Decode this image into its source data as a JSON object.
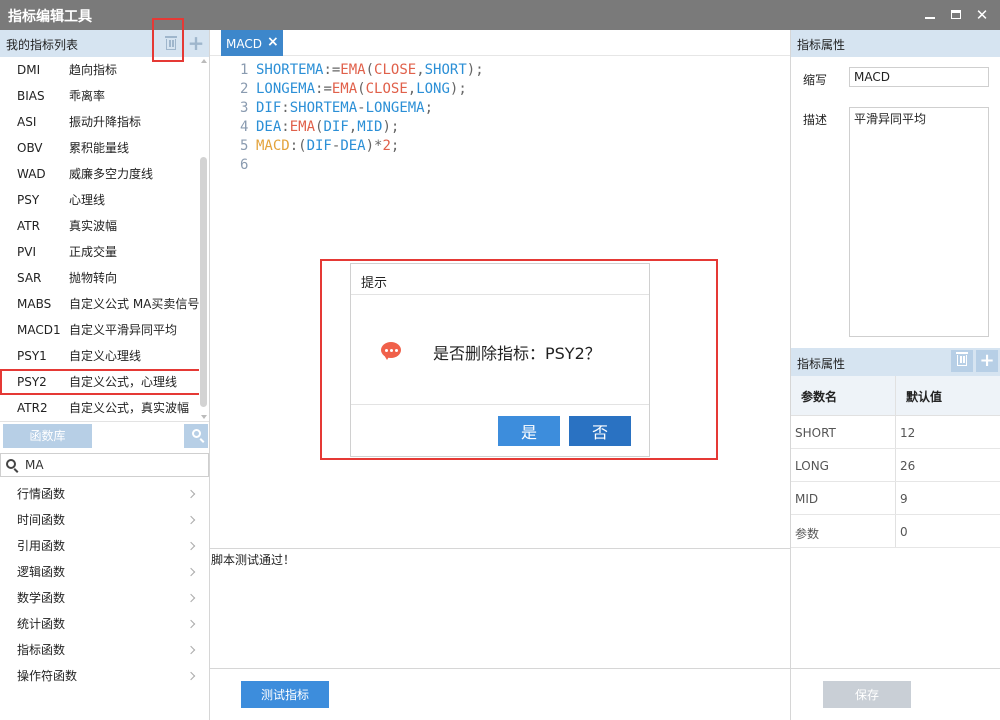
{
  "window": {
    "title": "指标编辑工具"
  },
  "left": {
    "header": "我的指标列表",
    "indicators": [
      {
        "code": "DMI",
        "name": "趋向指标"
      },
      {
        "code": "BIAS",
        "name": "乖离率"
      },
      {
        "code": "ASI",
        "name": "振动升降指标"
      },
      {
        "code": "OBV",
        "name": "累积能量线"
      },
      {
        "code": "WAD",
        "name": "威廉多空力度线"
      },
      {
        "code": "PSY",
        "name": "心理线"
      },
      {
        "code": "ATR",
        "name": "真实波幅"
      },
      {
        "code": "PVI",
        "name": "正成交量"
      },
      {
        "code": "SAR",
        "name": "抛物转向"
      },
      {
        "code": "MABS",
        "name": "自定义公式 MA买卖信号"
      },
      {
        "code": "MACD1",
        "name": "自定义平滑异同平均"
      },
      {
        "code": "PSY1",
        "name": "自定义心理线"
      },
      {
        "code": "PSY2",
        "name": "自定义公式，心理线"
      },
      {
        "code": "ATR2",
        "name": "自定义公式，真实波幅"
      }
    ],
    "func_lib_label": "函数库",
    "search_value": "MA",
    "categories": [
      "行情函数",
      "时间函数",
      "引用函数",
      "逻辑函数",
      "数学函数",
      "统计函数",
      "指标函数",
      "操作符函数"
    ]
  },
  "editor": {
    "tab_label": "MACD",
    "line_numbers": [
      "1",
      "2",
      "3",
      "4",
      "5",
      "6"
    ],
    "console_message": "脚本测试通过！",
    "test_button": "测试指标"
  },
  "right": {
    "header": "指标属性",
    "abbr_label": "缩写",
    "abbr_value": "MACD",
    "desc_label": "描述",
    "desc_value": "平滑异同平均",
    "params_header": "指标属性",
    "param_col_name": "参数名",
    "param_col_default": "默认值",
    "params": [
      {
        "name": "SHORT",
        "value": "12"
      },
      {
        "name": "LONG",
        "value": "26"
      },
      {
        "name": "MID",
        "value": "9"
      },
      {
        "name": "参数",
        "value": "0"
      }
    ],
    "save_button": "保存"
  },
  "dialog": {
    "title": "提示",
    "message": "是否删除指标：PSY2？",
    "yes": "是",
    "no": "否"
  },
  "colors": {
    "accent": "#3d8ddc",
    "header_bg": "#d6e4f1",
    "highlight_border": "#e53935"
  }
}
